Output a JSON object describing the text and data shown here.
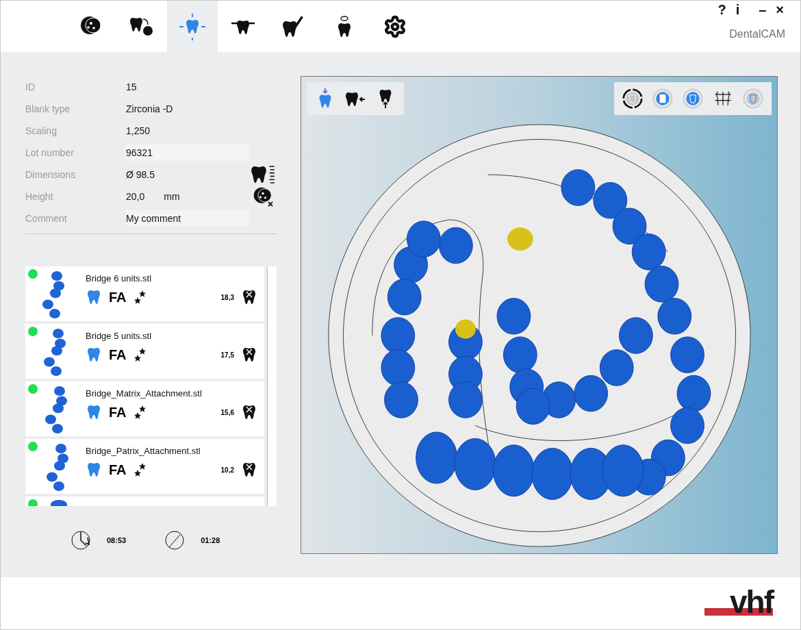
{
  "nav": {
    "tabs": [
      {
        "kind": "disc",
        "selected": false
      },
      {
        "kind": "tooth-swap",
        "selected": false
      },
      {
        "kind": "tooth-move",
        "selected": true
      },
      {
        "kind": "tooth-bar",
        "selected": false
      },
      {
        "kind": "tooth-pen",
        "selected": false
      },
      {
        "kind": "tooth-eye",
        "selected": false
      },
      {
        "kind": "settings",
        "selected": false
      }
    ]
  },
  "window": {
    "help": "?",
    "info": "i",
    "minimize": "–",
    "close": "×",
    "title": "DentalCAM"
  },
  "properties": [
    {
      "label": "ID",
      "value": "15"
    },
    {
      "label": "Blank type",
      "value": "Zirconia -D"
    },
    {
      "label": "Scaling",
      "value": "1,250"
    },
    {
      "label": "Lot number",
      "value": "96321",
      "kind": "field"
    },
    {
      "label": "Dimensions",
      "value": "Ø 98.5"
    },
    {
      "label": "Height",
      "value": "20,0",
      "unit": "mm"
    },
    {
      "label": "Comment",
      "value": "My comment",
      "kind": "field"
    }
  ],
  "objects": [
    {
      "name": "Bridge 6 units.stl",
      "tag": "FA",
      "value": "18,3",
      "color": "#22dd55"
    },
    {
      "name": "Bridge 5 units.stl",
      "tag": "FA",
      "value": "17,5",
      "color": "#22dd55"
    },
    {
      "name": "Bridge_Matrix_Attachment.stl",
      "tag": "FA",
      "value": "15,6",
      "color": "#22dd55"
    },
    {
      "name": "Bridge_Patrix_Attachment.stl",
      "tag": "FA",
      "value": "10,2",
      "color": "#22dd55"
    },
    {
      "color": "#22dd55"
    }
  ],
  "timers": [
    {
      "kind": "elapsed",
      "value": "08:53"
    },
    {
      "kind": "remaining",
      "value": "01:28"
    }
  ],
  "viewport": {
    "tools": [
      {
        "kind": "tooth-down",
        "selected": true
      },
      {
        "kind": "tooth-left",
        "selected": false
      },
      {
        "kind": "tooth-up",
        "selected": false
      }
    ],
    "views": [
      {
        "kind": "ring",
        "selected": true
      },
      {
        "kind": "square",
        "selected": false
      },
      {
        "kind": "filled",
        "selected": false
      },
      {
        "kind": "bridge",
        "selected": false
      },
      {
        "kind": "faded",
        "selected": false
      }
    ]
  },
  "footer": {
    "logo": "vhf"
  }
}
